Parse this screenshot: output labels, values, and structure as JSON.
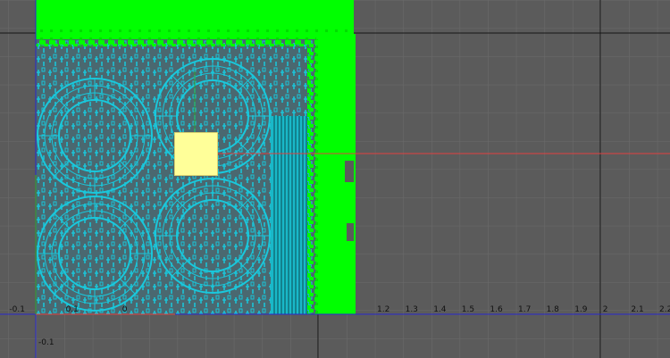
{
  "viewport": {
    "name": "UV Texture Editor",
    "background_color": "#5b5b5b",
    "grid_color": "#6a6a6a",
    "major_grid_color": "#161616",
    "u_axis_color": "#e04040",
    "v_axis_color": "#30a030",
    "origin_axis_color": "#2a2acc"
  },
  "u_axis_labels": [
    {
      "value": "-0.1",
      "u": -0.1
    },
    {
      "value": "0.1",
      "u": 0.1
    },
    {
      "value": "0",
      "u": 0.3
    },
    {
      "value": "1.2",
      "u": 1.2
    },
    {
      "value": "1.3",
      "u": 1.3
    },
    {
      "value": "1.4",
      "u": 1.4
    },
    {
      "value": "1.5",
      "u": 1.5
    },
    {
      "value": "1.6",
      "u": 1.6
    },
    {
      "value": "1.7",
      "u": 1.7
    },
    {
      "value": "1.8",
      "u": 1.8
    },
    {
      "value": "1.9",
      "u": 1.9
    },
    {
      "value": "2",
      "u": 2.0
    },
    {
      "value": "2.1",
      "u": 2.1
    },
    {
      "value": "2.2",
      "u": 2.2
    }
  ],
  "v_axis_labels": [
    {
      "value": "-0.1",
      "v": -0.1
    }
  ],
  "uv_shells": {
    "wire_color": "#19c8dc",
    "mesh_fill_color": "#4d6a70",
    "border_edge_color": "#00ff00",
    "pivot_color": "#ffff99"
  }
}
